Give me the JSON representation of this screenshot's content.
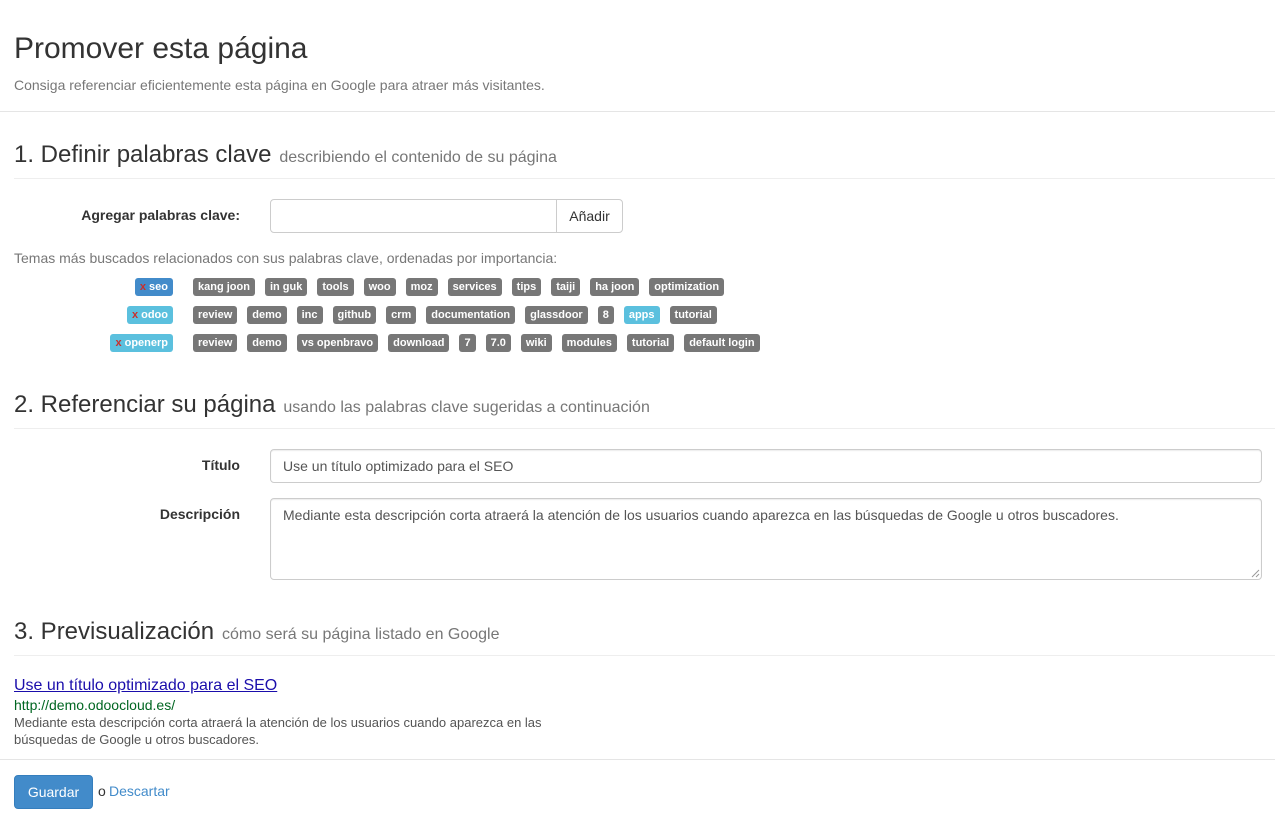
{
  "header": {
    "title": "Promover esta página",
    "subtitle": "Consiga referenciar eficientemente esta página en Google para atraer más visitantes."
  },
  "section1": {
    "title": "1. Definir palabras clave",
    "subtitle": "describiendo el contenido de su página",
    "add_label": "Agregar palabras clave:",
    "input_value": "",
    "add_button": "Añadir",
    "hint": "Temas más buscados relacionados con sus palabras clave, ordenadas por importancia:",
    "remove_glyph": "x",
    "keywords": [
      {
        "name": "seo",
        "style": "primary",
        "related": [
          "kang joon",
          "in guk",
          "tools",
          "woo",
          "moz",
          "services",
          "tips",
          "taiji",
          "ha joon",
          "optimization"
        ]
      },
      {
        "name": "odoo",
        "style": "info",
        "related": [
          "review",
          "demo",
          "inc",
          "github",
          "crm",
          "documentation",
          "glassdoor",
          "8",
          "apps",
          "tutorial"
        ]
      },
      {
        "name": "openerp",
        "style": "info",
        "related": [
          "review",
          "demo",
          "vs openbravo",
          "download",
          "7",
          "7.0",
          "wiki",
          "modules",
          "tutorial",
          "default login"
        ]
      }
    ],
    "highlighted_related": "apps"
  },
  "section2": {
    "title": "2. Referenciar su página",
    "subtitle": "usando las palabras clave sugeridas a continuación",
    "title_label": "Título",
    "title_value": "Use un título optimizado para el SEO",
    "desc_label": "Descripción",
    "desc_value": "Mediante esta descripción corta atraerá la atención de los usuarios cuando aparezca en las búsquedas de Google u otros buscadores."
  },
  "section3": {
    "title": "3. Previsualización",
    "subtitle": "cómo será su página listado en Google",
    "preview_title": "Use un título optimizado para el SEO",
    "preview_url": "http://demo.odoocloud.es/",
    "preview_desc": "Mediante esta descripción corta atraerá la atención de los usuarios cuando aparezca en las búsquedas de Google u otros buscadores."
  },
  "footer": {
    "save": "Guardar",
    "or": "o",
    "discard": "Descartar"
  },
  "colors": {
    "primary": "#428bca",
    "info": "#5bc0de",
    "default_tag": "#777777",
    "link": "#1a0dab",
    "url": "#006621"
  }
}
